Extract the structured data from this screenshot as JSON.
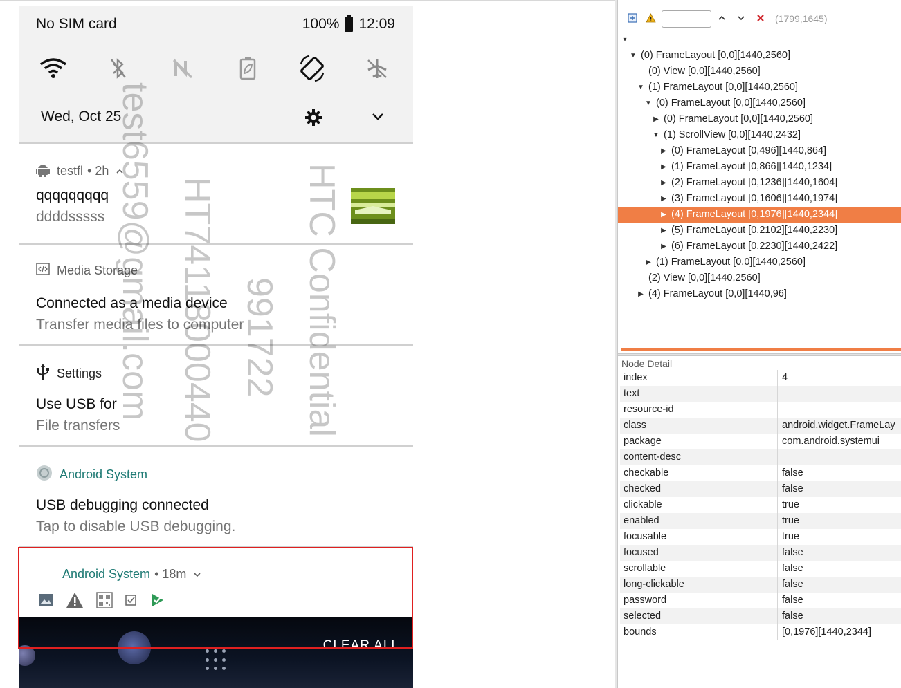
{
  "status_bar": {
    "carrier": "No SIM card",
    "battery": "100%",
    "time": "12:09"
  },
  "quick_settings": {
    "tiles": [
      "wifi-icon",
      "bluetooth-off-icon",
      "nfc-off-icon",
      "battery-saver-icon",
      "auto-rotate-icon",
      "airplane-mode-icon"
    ],
    "date": "Wed, Oct 25"
  },
  "notifications": [
    {
      "app": "testfl",
      "time": "• 2h",
      "title": "qqqqqqqqq",
      "text": "ddddsssss",
      "icon": "android-icon"
    },
    {
      "app": "Media Storage",
      "title": "Connected as a media device",
      "text": "Transfer media files to computer",
      "icon": "code-icon"
    },
    {
      "app": "Settings",
      "title": "Use USB for",
      "text": "File transfers",
      "icon": "usb-icon"
    },
    {
      "app": "Android System",
      "title": "USB debugging connected",
      "text": "Tap to disable USB debugging.",
      "icon": "android-system-icon",
      "accent": "#1e7a74"
    },
    {
      "app": "Android System",
      "time": "• 18m",
      "accent": "#1e7a74",
      "icons": [
        "image-icon",
        "warning-icon",
        "qr-icon",
        "checkbox-icon",
        "play-check-icon"
      ]
    }
  ],
  "clear_all": "CLEAR ALL",
  "watermark": {
    "lines": [
      "HTC Confidential",
      "991722",
      "HT74118000440",
      "test6559@gmail.com"
    ]
  },
  "highlight_color": "#e02020",
  "toolbar": {
    "search_value": "",
    "coords": "(1799,1645)"
  },
  "tree": {
    "root_arrow": "▾",
    "nodes": [
      {
        "label": "(0) FrameLayout [0,0][1440,2560]",
        "depth": 0,
        "toggle": "open"
      },
      {
        "label": "(0) View [0,0][1440,2560]",
        "depth": 1,
        "toggle": "none"
      },
      {
        "label": "(1) FrameLayout [0,0][1440,2560]",
        "depth": 1,
        "toggle": "open"
      },
      {
        "label": "(0) FrameLayout [0,0][1440,2560]",
        "depth": 2,
        "toggle": "open"
      },
      {
        "label": "(0) FrameLayout [0,0][1440,2560]",
        "depth": 3,
        "toggle": "closed"
      },
      {
        "label": "(1) ScrollView [0,0][1440,2432]",
        "depth": 3,
        "toggle": "open"
      },
      {
        "label": "(0) FrameLayout [0,496][1440,864]",
        "depth": 4,
        "toggle": "closed"
      },
      {
        "label": "(1) FrameLayout [0,866][1440,1234]",
        "depth": 4,
        "toggle": "closed"
      },
      {
        "label": "(2) FrameLayout [0,1236][1440,1604]",
        "depth": 4,
        "toggle": "closed"
      },
      {
        "label": "(3) FrameLayout [0,1606][1440,1974]",
        "depth": 4,
        "toggle": "closed"
      },
      {
        "label": "(4) FrameLayout [0,1976][1440,2344]",
        "depth": 4,
        "toggle": "closed",
        "selected": true
      },
      {
        "label": "(5) FrameLayout [0,2102][1440,2230]",
        "depth": 4,
        "toggle": "closed"
      },
      {
        "label": "(6) FrameLayout [0,2230][1440,2422]",
        "depth": 4,
        "toggle": "closed"
      },
      {
        "label": "(1) FrameLayout [0,0][1440,2560]",
        "depth": 2,
        "toggle": "closed"
      },
      {
        "label": "(2) View [0,0][1440,2560]",
        "depth": 1,
        "toggle": "none"
      },
      {
        "label": "(4) FrameLayout [0,0][1440,96]",
        "depth": 1,
        "toggle": "closed"
      }
    ],
    "selected_color": "#f07e45"
  },
  "node_detail": {
    "title": "Node Detail",
    "properties": [
      {
        "key": "index",
        "value": "4"
      },
      {
        "key": "text",
        "value": ""
      },
      {
        "key": "resource-id",
        "value": ""
      },
      {
        "key": "class",
        "value": "android.widget.FrameLay"
      },
      {
        "key": "package",
        "value": "com.android.systemui"
      },
      {
        "key": "content-desc",
        "value": ""
      },
      {
        "key": "checkable",
        "value": "false"
      },
      {
        "key": "checked",
        "value": "false"
      },
      {
        "key": "clickable",
        "value": "true"
      },
      {
        "key": "enabled",
        "value": "true"
      },
      {
        "key": "focusable",
        "value": "true"
      },
      {
        "key": "focused",
        "value": "false"
      },
      {
        "key": "scrollable",
        "value": "false"
      },
      {
        "key": "long-clickable",
        "value": "false"
      },
      {
        "key": "password",
        "value": "false"
      },
      {
        "key": "selected",
        "value": "false"
      },
      {
        "key": "bounds",
        "value": "[0,1976][1440,2344]"
      }
    ]
  }
}
